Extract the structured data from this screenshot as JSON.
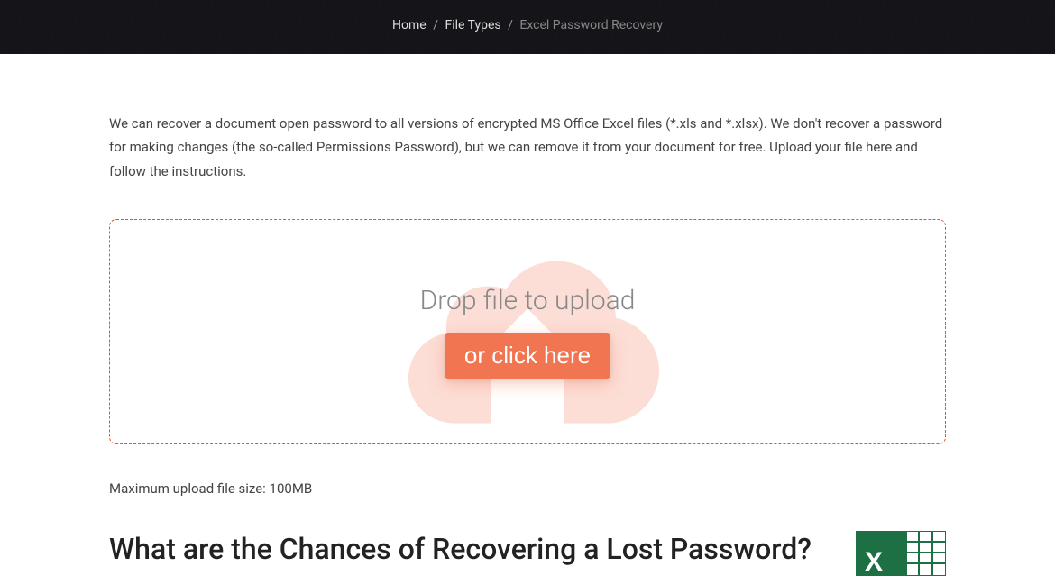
{
  "breadcrumb": {
    "home": "Home",
    "file_types": "File Types",
    "current": "Excel Password Recovery"
  },
  "intro": "We can recover a document open password to all versions of encrypted MS Office Excel files (*.xls and *.xlsx). We don't recover a password for making changes (the so-called Permissions Password), but we can remove it from your document for free. Upload your file here and follow the instructions.",
  "upload": {
    "drop_label": "Drop file to upload",
    "click_label": "or click here",
    "max_size": "Maximum upload file size: 100MB"
  },
  "section": {
    "title": "What are the Chances of Recovering a Lost Password?"
  }
}
